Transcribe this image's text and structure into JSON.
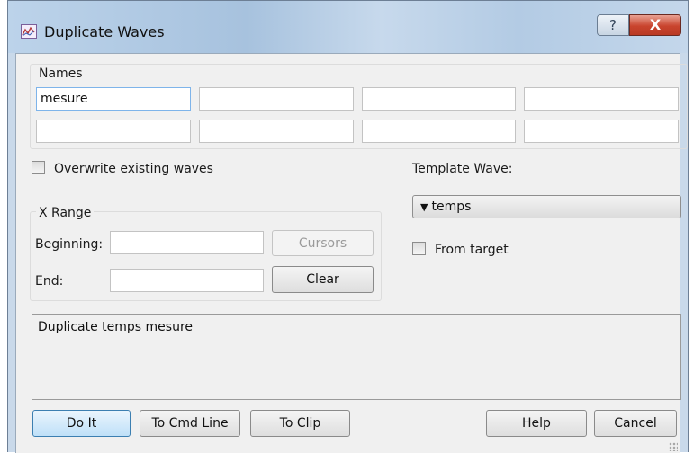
{
  "window": {
    "title": "Duplicate Waves",
    "help_glyph": "?",
    "close_glyph": "X"
  },
  "names": {
    "group_label": "Names",
    "fields": [
      "mesure",
      "",
      "",
      "",
      "",
      "",
      "",
      ""
    ]
  },
  "overwrite": {
    "label": "Overwrite existing waves",
    "checked": false
  },
  "x_range": {
    "group_label": "X Range",
    "beginning_label": "Beginning:",
    "beginning_value": "",
    "end_label": "End:",
    "end_value": "",
    "cursors_label": "Cursors",
    "clear_label": "Clear"
  },
  "template": {
    "label": "Template Wave:",
    "selected": "temps",
    "arrow_glyph": "▼",
    "from_target_label": "From target",
    "from_target_checked": false
  },
  "command_text": "Duplicate temps mesure",
  "buttons": {
    "do_it": "Do It",
    "to_cmd_line": "To Cmd Line",
    "to_clip": "To Clip",
    "help": "Help",
    "cancel": "Cancel"
  }
}
